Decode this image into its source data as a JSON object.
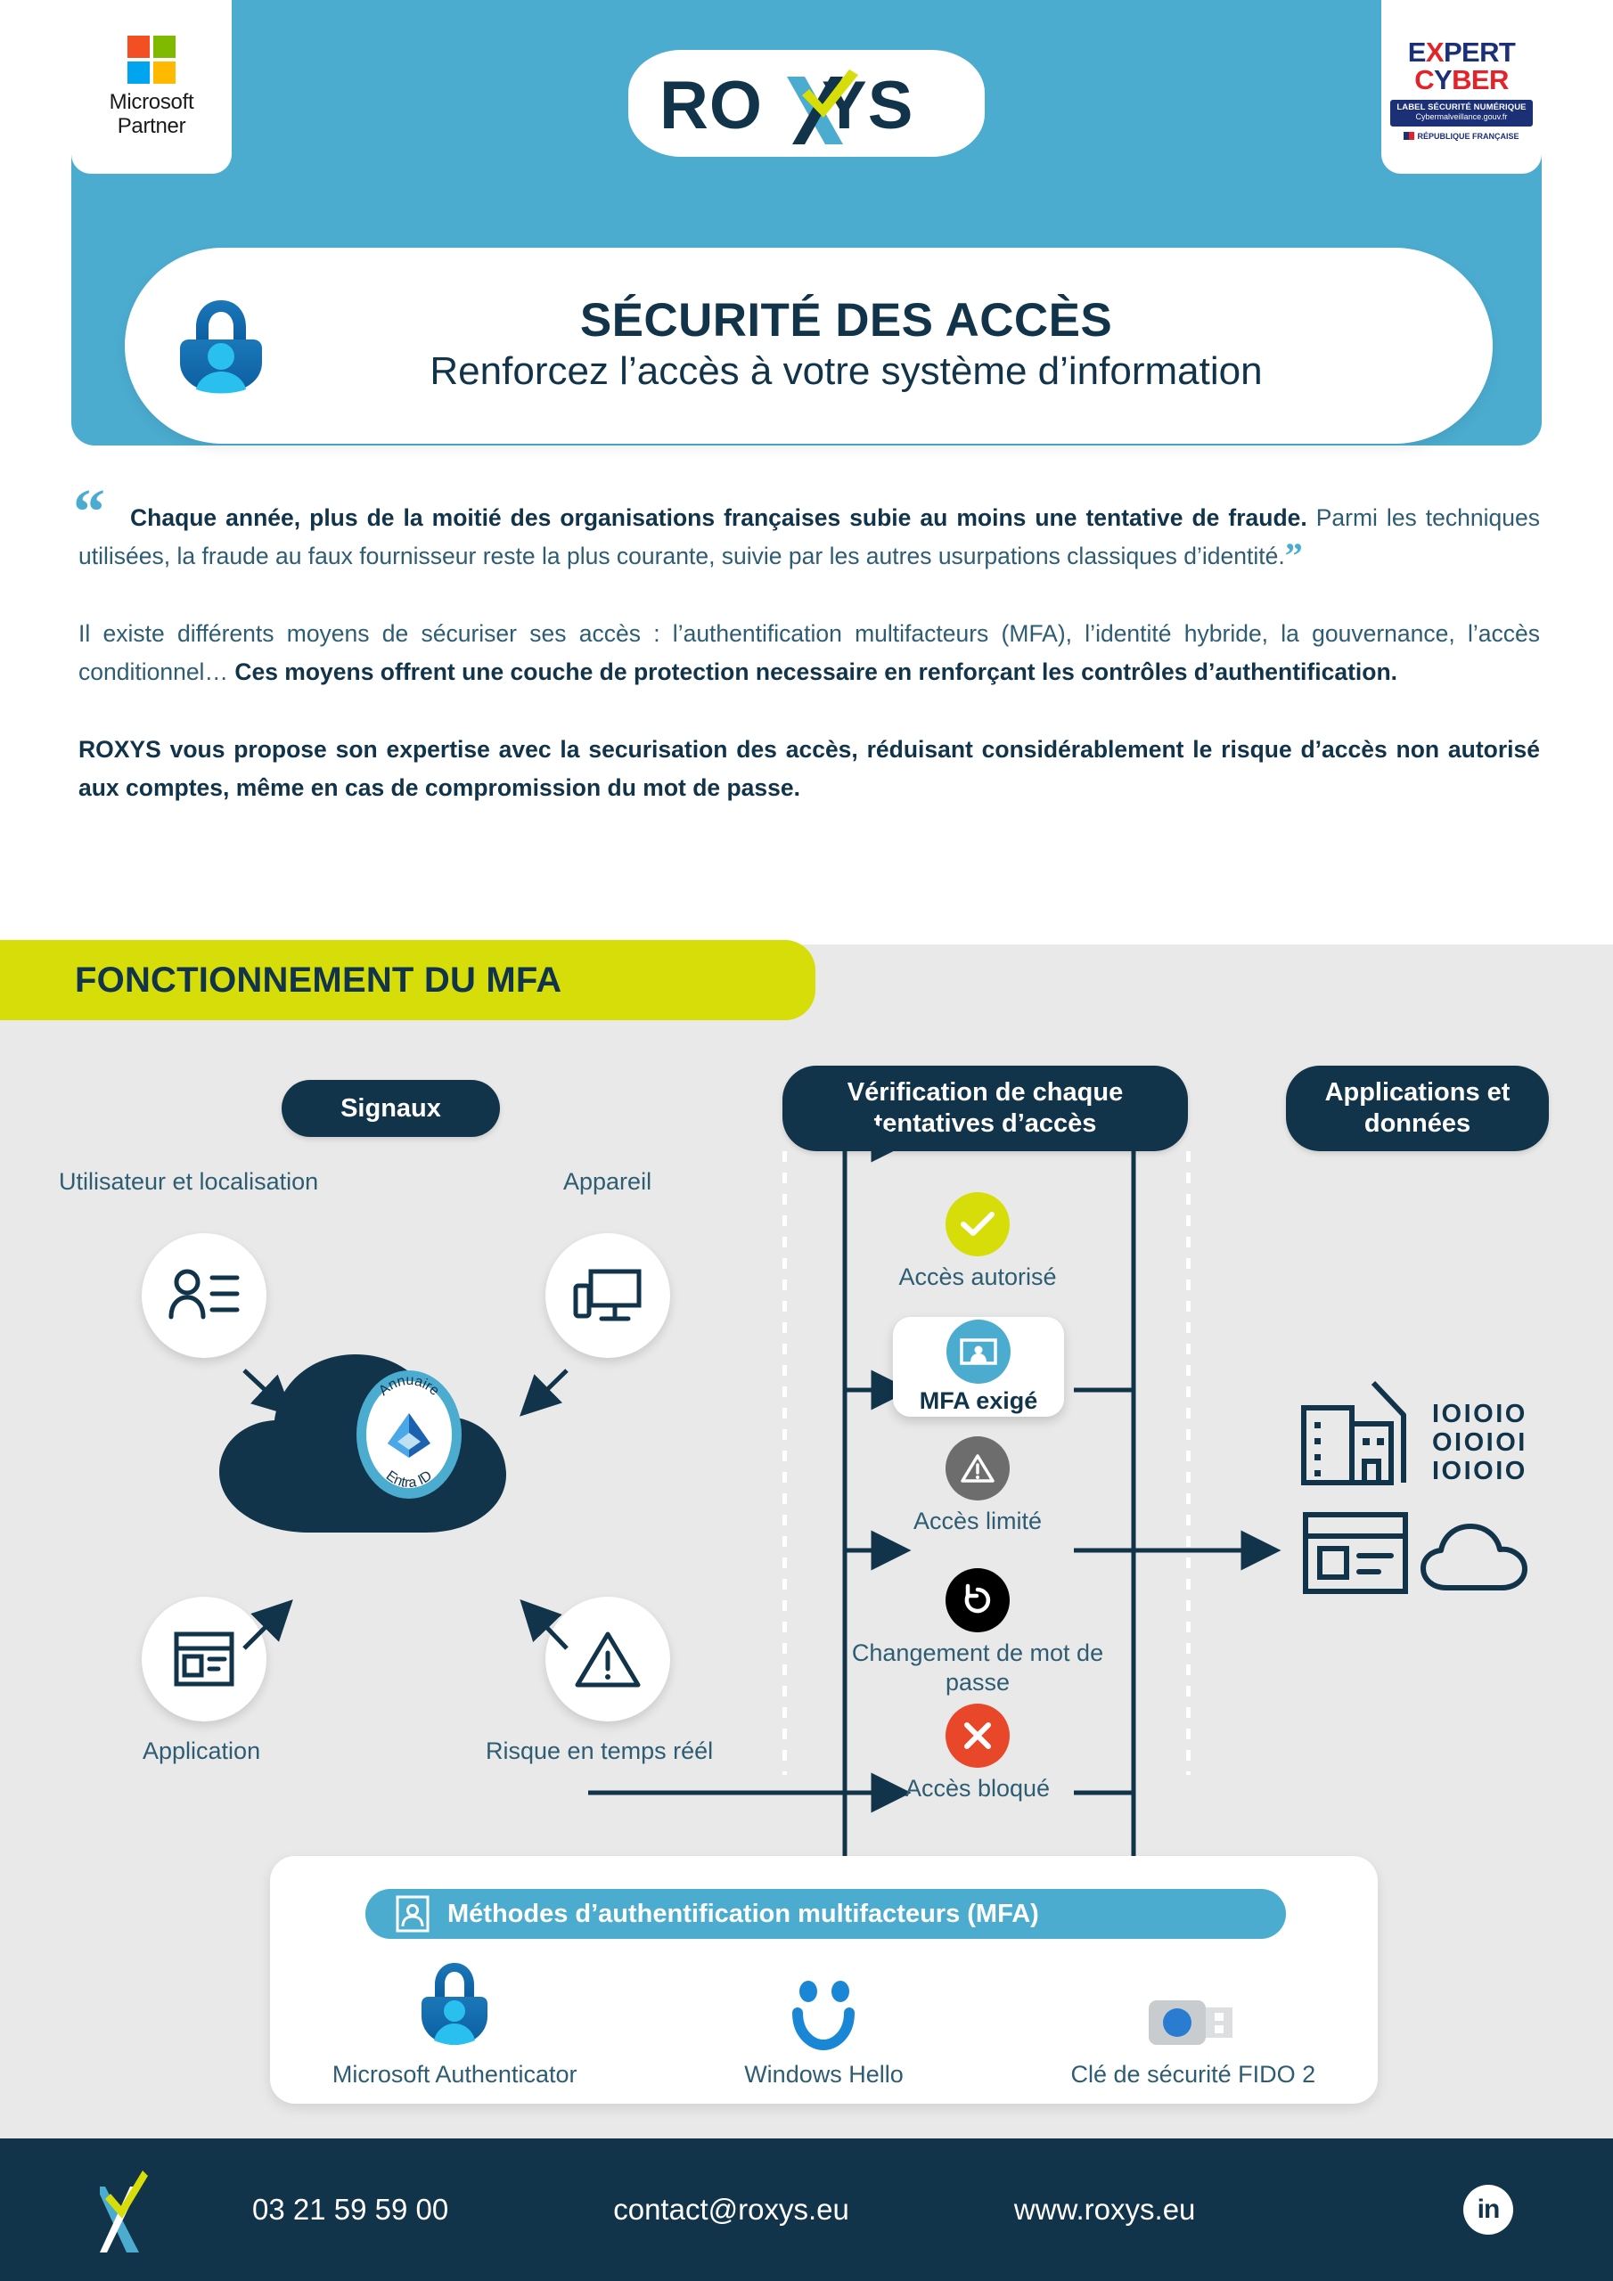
{
  "brand": {
    "name": "ROXYS",
    "accent_blue": "#4bacd0",
    "dark_navy": "#12344b",
    "lime": "#d6dd09",
    "red": "#e8472a",
    "gray_icon": "#6d6d6d"
  },
  "header": {
    "ms_partner": {
      "line1": "Microsoft",
      "line2": "Partner"
    },
    "expert_cyber": {
      "word1": "EXPERT",
      "word2": "CYBER",
      "label_line1": "LABEL SÉCURITÉ NUMÉRIQUE",
      "label_line2": "Cybermalveillance.gouv.fr",
      "republic": "RÉPUBLIQUE FRANÇAISE"
    },
    "logo_text": "ROXYS",
    "title": "SÉCURITÉ DES ACCÈS",
    "subtitle": "Renforcez l’accès à votre système d’information"
  },
  "intro": {
    "quote_bold": "Chaque année, plus de la moitié des organisations françaises subie au moins une tentative de fraude.",
    "quote_rest": " Parmi les techniques utilisées, la fraude au faux fournisseur reste la plus courante, suivie par les autres usurpations classiques d’identité.",
    "para2_normal": "Il existe différents moyens de sécuriser ses accès : l’authentification multifacteurs (MFA), l’identité hybride, la gouvernance, l’accès conditionnel… ",
    "para2_bold": "Ces moyens offrent une couche de protection necessaire en renforçant les contrôles d’authentification.",
    "para3": "ROXYS vous propose son expertise avec la securisation des accès, réduisant considérablement le risque d’accès non autorisé aux comptes, même en cas de compromission du mot de passe."
  },
  "section": {
    "title": "FONCTIONNEMENT DU MFA"
  },
  "diagram": {
    "pills": {
      "signals": "Signaux",
      "verification": "Vérification de chaque tentatives d’accès",
      "applications": "Applications et données"
    },
    "signals": [
      {
        "label": "Utilisateur et localisation",
        "icon": "user-list-icon"
      },
      {
        "label": "Appareil",
        "icon": "device-icon"
      },
      {
        "label": "Application",
        "icon": "application-window-icon"
      },
      {
        "label": "Risque en temps réél",
        "icon": "warning-triangle-icon"
      }
    ],
    "cloud": {
      "line1": "Annuaire",
      "line2": "Entra ID"
    },
    "outcomes": [
      {
        "label": "Accès autorisé",
        "icon": "check-icon",
        "color": "#d6dd09"
      },
      {
        "label": "MFA exigé",
        "icon": "mfa-badge-icon",
        "color": "#4bacd0",
        "highlighted": true
      },
      {
        "label": "Accès limité",
        "icon": "warning-icon",
        "color": "#6d6d6d"
      },
      {
        "label": "Changement de mot de passe",
        "icon": "reset-arrow-icon",
        "color": "#000000"
      },
      {
        "label": "Accès bloqué",
        "icon": "cross-icon",
        "color": "#e8472a"
      }
    ],
    "app_data_icons": [
      "buildings-icon",
      "binary-data-icon",
      "browser-window-icon",
      "cloud-icon"
    ],
    "binary": {
      "row1": "IOIOIO",
      "row2": "OIOIOI",
      "row3": "IOIOIO"
    }
  },
  "methods": {
    "heading": "Méthodes d’authentification multifacteurs (MFA)",
    "items": [
      {
        "label": "Microsoft Authenticator",
        "icon": "authenticator-lock-icon"
      },
      {
        "label": "Windows Hello",
        "icon": "smiley-face-icon"
      },
      {
        "label": "Clé de sécurité FIDO 2",
        "icon": "usb-security-key-icon"
      }
    ]
  },
  "footer": {
    "phone": "03 21 59 59 00",
    "email": "contact@roxys.eu",
    "website": "www.roxys.eu",
    "social": "in"
  }
}
